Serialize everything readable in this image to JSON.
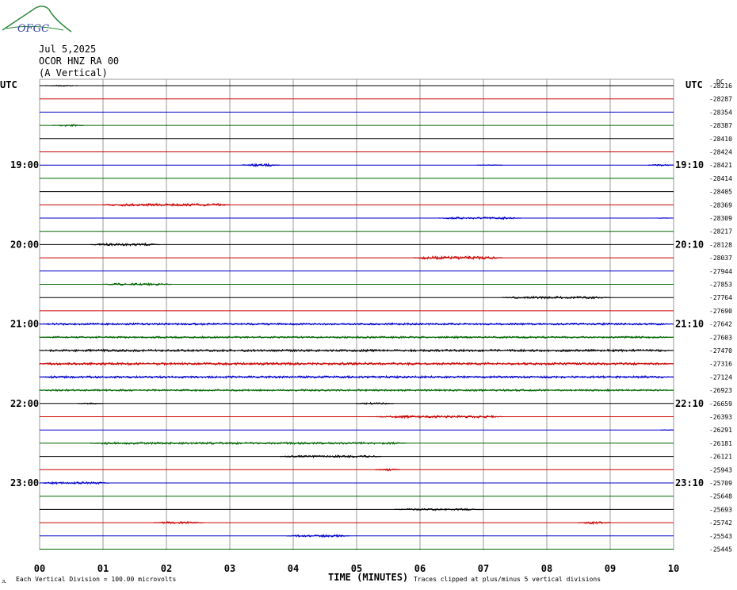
{
  "header": {
    "logo_text": "OFGC",
    "date": "Jul 5,2025",
    "station": "OCOR HNZ RA 00",
    "component": "(A Vertical)",
    "utc_left": "UTC",
    "utc_right": "UTC",
    "dc_label": "DC"
  },
  "footer": {
    "scale_note": "Each Vertical Division =  100.00 microvolts",
    "clip_note": "Traces clipped at plus/minus 5 vertical divisions",
    "corner_mark": "JL"
  },
  "chart_data": {
    "type": "line",
    "title": "Jul 5,2025",
    "xlabel": "TIME (MINUTES)",
    "ylabel": "",
    "x_ticks": [
      "00",
      "01",
      "02",
      "03",
      "04",
      "05",
      "06",
      "07",
      "08",
      "09",
      "10"
    ],
    "xlim": [
      0,
      10
    ],
    "grid": true,
    "left_hour_labels": [
      {
        "row": 6,
        "label": "19:00"
      },
      {
        "row": 12,
        "label": "20:00"
      },
      {
        "row": 18,
        "label": "21:00"
      },
      {
        "row": 24,
        "label": "22:00"
      },
      {
        "row": 30,
        "label": "23:00"
      }
    ],
    "right_hour_labels": [
      {
        "row": 6,
        "label": "19:10"
      },
      {
        "row": 12,
        "label": "20:10"
      },
      {
        "row": 18,
        "label": "21:10"
      },
      {
        "row": 24,
        "label": "22:10"
      },
      {
        "row": 30,
        "label": "23:10"
      }
    ],
    "trace_colors": [
      "#000000",
      "#cc0000",
      "#0000cc",
      "#006600"
    ],
    "dc_offsets": [
      -28216,
      -28287,
      -28354,
      -28387,
      -28410,
      -28424,
      -28421,
      -28414,
      -28405,
      -28369,
      -28309,
      -28217,
      -28128,
      -28037,
      -27944,
      -27853,
      -27764,
      -27690,
      -27642,
      -27603,
      -27470,
      -27316,
      -27124,
      -26923,
      -26659,
      -26393,
      -26291,
      -26181,
      -26121,
      -25943,
      -25709,
      -25648,
      -25693,
      -25742,
      -25543,
      -25445
    ],
    "activity": [
      [
        [
          0.1,
          0.6,
          0.8
        ]
      ],
      [],
      [],
      [
        [
          0.2,
          0.7,
          1.3
        ]
      ],
      [],
      [],
      [
        [
          3.2,
          3.8,
          1.5
        ],
        [
          6.9,
          7.3,
          0.6
        ],
        [
          9.6,
          10.0,
          1.2
        ]
      ],
      [],
      [],
      [
        [
          1.0,
          3.0,
          1.5
        ]
      ],
      [
        [
          6.3,
          7.6,
          1.3
        ],
        [
          9.7,
          10.0,
          0.6
        ]
      ],
      [],
      [
        [
          0.8,
          1.9,
          1.4
        ]
      ],
      [
        [
          5.9,
          7.3,
          1.8
        ]
      ],
      [],
      [
        [
          1.0,
          2.1,
          1.3
        ]
      ],
      [
        [
          7.3,
          9.0,
          1.3
        ]
      ],
      [],
      [
        [
          0.0,
          10.0,
          1.2
        ]
      ],
      [
        [
          0.0,
          10.0,
          1.1
        ]
      ],
      [
        [
          0.0,
          10.0,
          1.3
        ]
      ],
      [
        [
          0.0,
          10.0,
          1.4
        ]
      ],
      [
        [
          0.0,
          10.0,
          1.3
        ]
      ],
      [
        [
          0.0,
          10.0,
          1.1
        ]
      ],
      [
        [
          0.6,
          1.0,
          0.8
        ],
        [
          5.0,
          5.6,
          1.1
        ]
      ],
      [
        [
          5.3,
          7.3,
          1.4
        ]
      ],
      [
        [
          9.8,
          10.0,
          0.9
        ]
      ],
      [
        [
          0.8,
          5.8,
          1.2
        ]
      ],
      [
        [
          3.8,
          5.4,
          1.3
        ]
      ],
      [
        [
          5.3,
          5.7,
          1.6
        ]
      ],
      [
        [
          0.0,
          1.1,
          1.3
        ]
      ],
      [],
      [
        [
          5.6,
          7.0,
          1.1
        ]
      ],
      [
        [
          1.8,
          2.6,
          1.3
        ],
        [
          8.5,
          9.0,
          1.6
        ]
      ],
      [
        [
          3.9,
          4.9,
          1.3
        ]
      ],
      []
    ]
  }
}
